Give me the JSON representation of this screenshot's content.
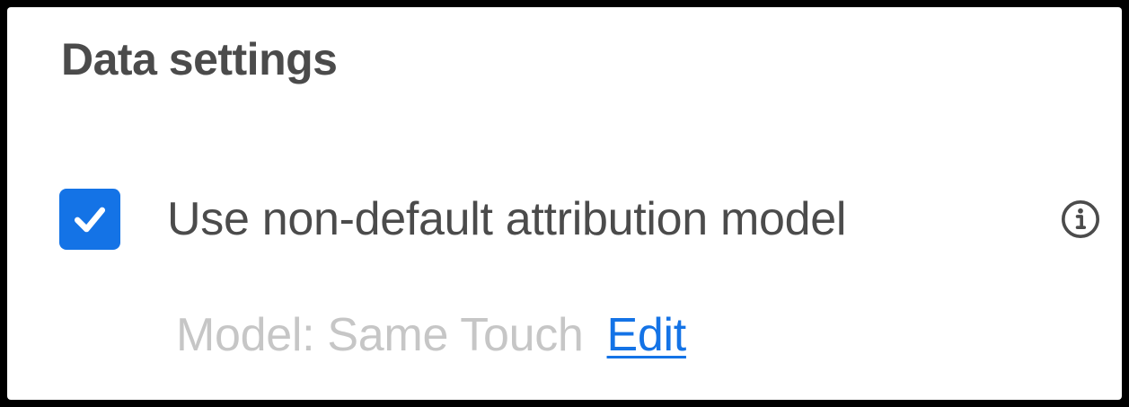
{
  "section": {
    "title": "Data settings"
  },
  "attribution": {
    "checked": true,
    "label": "Use non-default attribution model",
    "info_icon": "info-icon",
    "model_text": "Model: Same Touch",
    "edit_label": "Edit"
  },
  "colors": {
    "accent": "#1473e6",
    "text": "#4b4b4b",
    "disabled_text": "#c6c6c6"
  }
}
